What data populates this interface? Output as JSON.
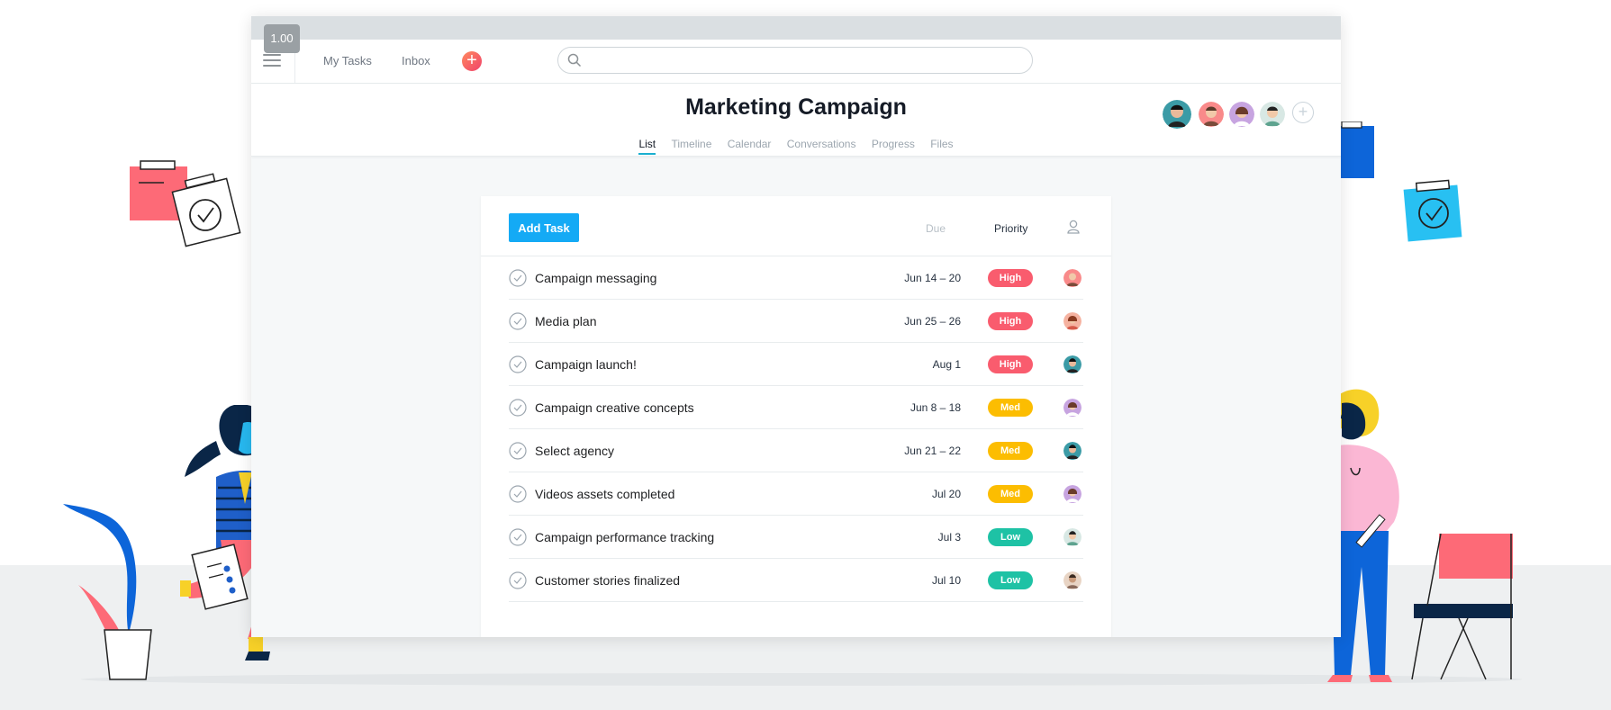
{
  "zoom_badge": "1.00",
  "topbar": {
    "my_tasks": "My Tasks",
    "inbox": "Inbox",
    "add_symbol": "+",
    "search_placeholder": ""
  },
  "project": {
    "title": "Marketing Campaign",
    "tabs": [
      {
        "label": "List",
        "active": true
      },
      {
        "label": "Timeline",
        "active": false
      },
      {
        "label": "Calendar",
        "active": false
      },
      {
        "label": "Conversations",
        "active": false
      },
      {
        "label": "Progress",
        "active": false
      },
      {
        "label": "Files",
        "active": false
      }
    ],
    "add_member_symbol": "+"
  },
  "list": {
    "add_task_label": "Add Task",
    "columns": {
      "due": "Due",
      "priority": "Priority"
    },
    "tasks": [
      {
        "name": "Campaign messaging",
        "due": "Jun 14 – 20",
        "priority": "High"
      },
      {
        "name": "Media plan",
        "due": "Jun 25 – 26",
        "priority": "High"
      },
      {
        "name": "Campaign launch!",
        "due": "Aug 1",
        "priority": "High"
      },
      {
        "name": "Campaign creative concepts",
        "due": "Jun 8 – 18",
        "priority": "Med"
      },
      {
        "name": "Select agency",
        "due": "Jun 21 – 22",
        "priority": "Med"
      },
      {
        "name": "Videos assets completed",
        "due": "Jul 20",
        "priority": "Med"
      },
      {
        "name": "Campaign performance tracking",
        "due": "Jul 3",
        "priority": "Low"
      },
      {
        "name": "Customer stories finalized",
        "due": "Jul 10",
        "priority": "Low"
      }
    ]
  },
  "colors": {
    "high": "#f95c6e",
    "med": "#fcbd01",
    "low": "#1ec2a5",
    "primary": "#14aaf5",
    "tab_underline": "#1aafd0"
  },
  "icons": {
    "menu": "hamburger-icon",
    "search": "search-icon",
    "check": "checkmark-circle-icon",
    "assignee": "person-icon",
    "add": "plus-icon"
  }
}
